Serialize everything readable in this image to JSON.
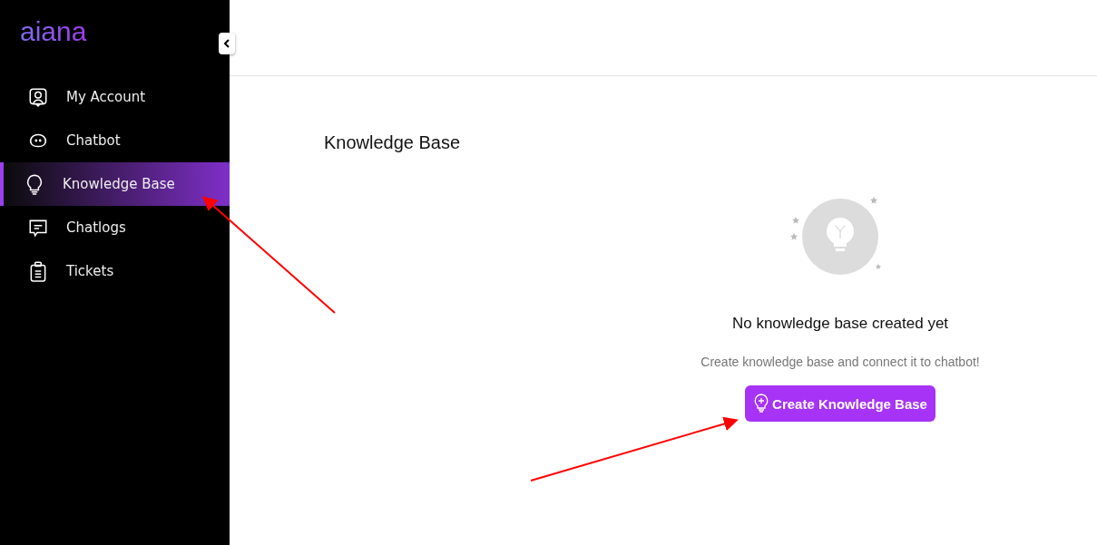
{
  "sidebar": {
    "logo": "aiana",
    "items": [
      {
        "label": "My Account",
        "selected": false
      },
      {
        "label": "Chatbot",
        "selected": false
      },
      {
        "label": "Knowledge Base",
        "selected": true
      },
      {
        "label": "Chatlogs",
        "selected": false
      },
      {
        "label": "Tickets",
        "selected": false
      }
    ]
  },
  "page": {
    "title": "Knowledge Base"
  },
  "empty_state": {
    "heading": "No knowledge base created yet",
    "message": "Create knowledge base and connect it to chatbot!",
    "button": "Create Knowledge Base"
  }
}
